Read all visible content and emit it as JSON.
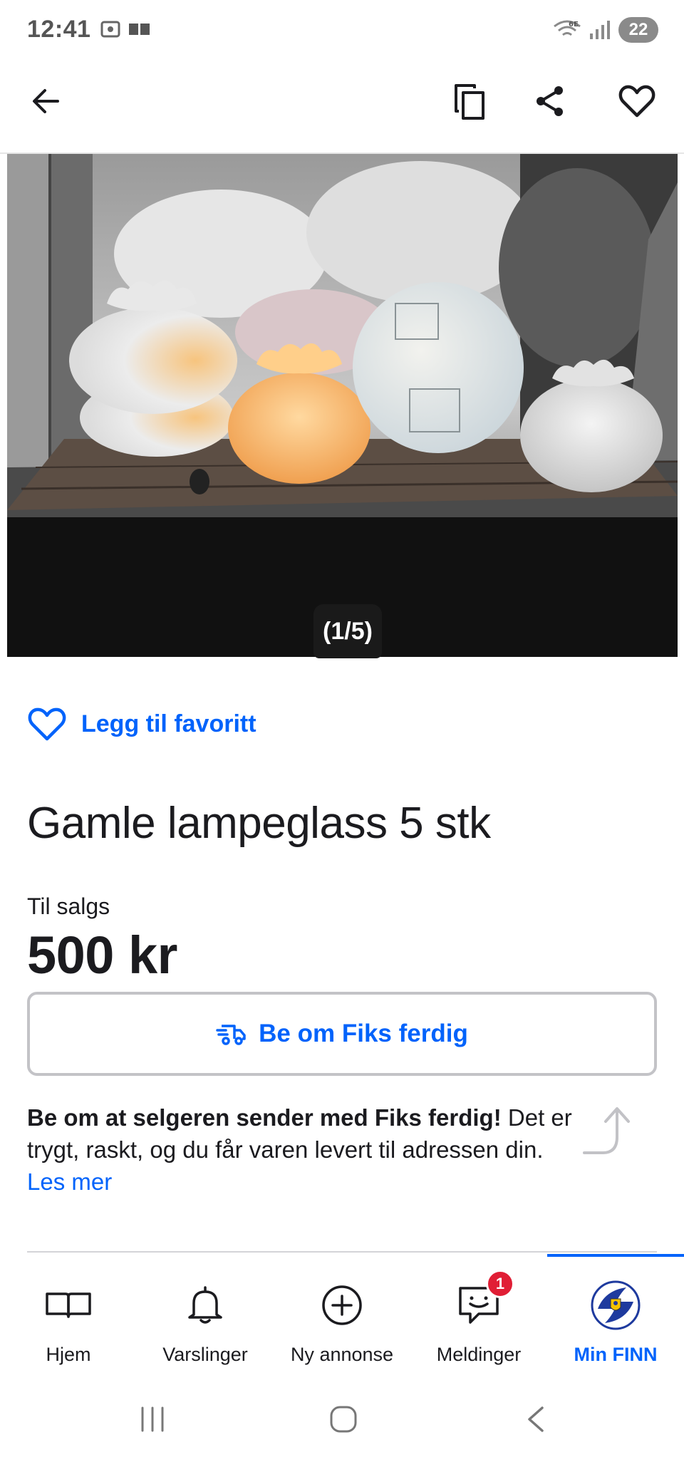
{
  "status_bar": {
    "time": "12:41",
    "network": "6E",
    "battery": "22"
  },
  "toolbar": {
    "back_icon": "arrow-left-icon",
    "copy_icon": "copy-icon",
    "share_icon": "share-icon",
    "favorite_icon": "heart-icon"
  },
  "gallery": {
    "counter": "(1/5)"
  },
  "listing": {
    "favorite_label": "Legg til favoritt",
    "title": "Gamle lampeglass 5 stk",
    "sale_type": "Til salgs",
    "price": "500 kr",
    "fiks_button": "Be om Fiks ferdig",
    "info_bold": "Be om at selgeren sender med Fiks ferdig!",
    "info_text": " Det er trygt, raskt, og du får varen levert til adressen din. ",
    "info_link": "Les mer"
  },
  "bottom_nav": {
    "items": [
      {
        "label": "Hjem",
        "icon": "book-icon",
        "active": false
      },
      {
        "label": "Varslinger",
        "icon": "bell-icon",
        "active": false
      },
      {
        "label": "Ny annonse",
        "icon": "plus-circle-icon",
        "active": false
      },
      {
        "label": "Meldinger",
        "icon": "chat-icon",
        "active": false,
        "badge": "1"
      },
      {
        "label": "Min FINN",
        "icon": "avatar",
        "active": true
      }
    ]
  },
  "colors": {
    "accent": "#0063fb",
    "badge": "#e01e35",
    "text": "#1b1b1f"
  }
}
